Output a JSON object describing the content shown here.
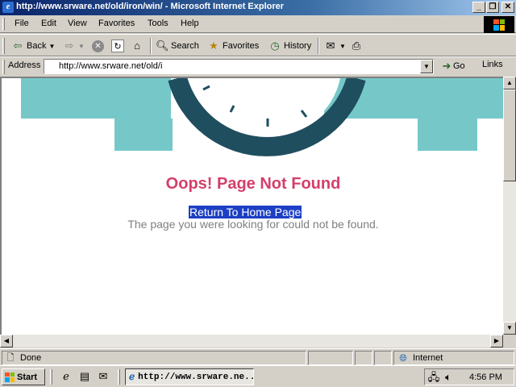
{
  "window": {
    "title": "http://www.srware.net/old/iron/win/ - Microsoft Internet Explorer",
    "buttons": {
      "minimize": "_",
      "maximize": "❐",
      "close": "✕"
    }
  },
  "menu": [
    "File",
    "Edit",
    "View",
    "Favorites",
    "Tools",
    "Help"
  ],
  "toolbar": {
    "back": "Back",
    "search": "Search",
    "favorites": "Favorites",
    "history": "History"
  },
  "address": {
    "label": "Address",
    "value": "http://www.srware.net/old/i",
    "go": "Go",
    "links": "Links"
  },
  "page": {
    "heading": "Oops! Page Not Found",
    "home_link": "Return To Home Page",
    "message": "The page you were looking for could not be found.",
    "colors": {
      "teal": "#76c8c8",
      "clock": "#1f4e5f",
      "heading": "#d43f6b"
    }
  },
  "status": {
    "text": "Done",
    "zone": "Internet"
  },
  "taskbar": {
    "start": "Start",
    "task": "http://www.srware.ne...",
    "time": "4:56 PM"
  }
}
